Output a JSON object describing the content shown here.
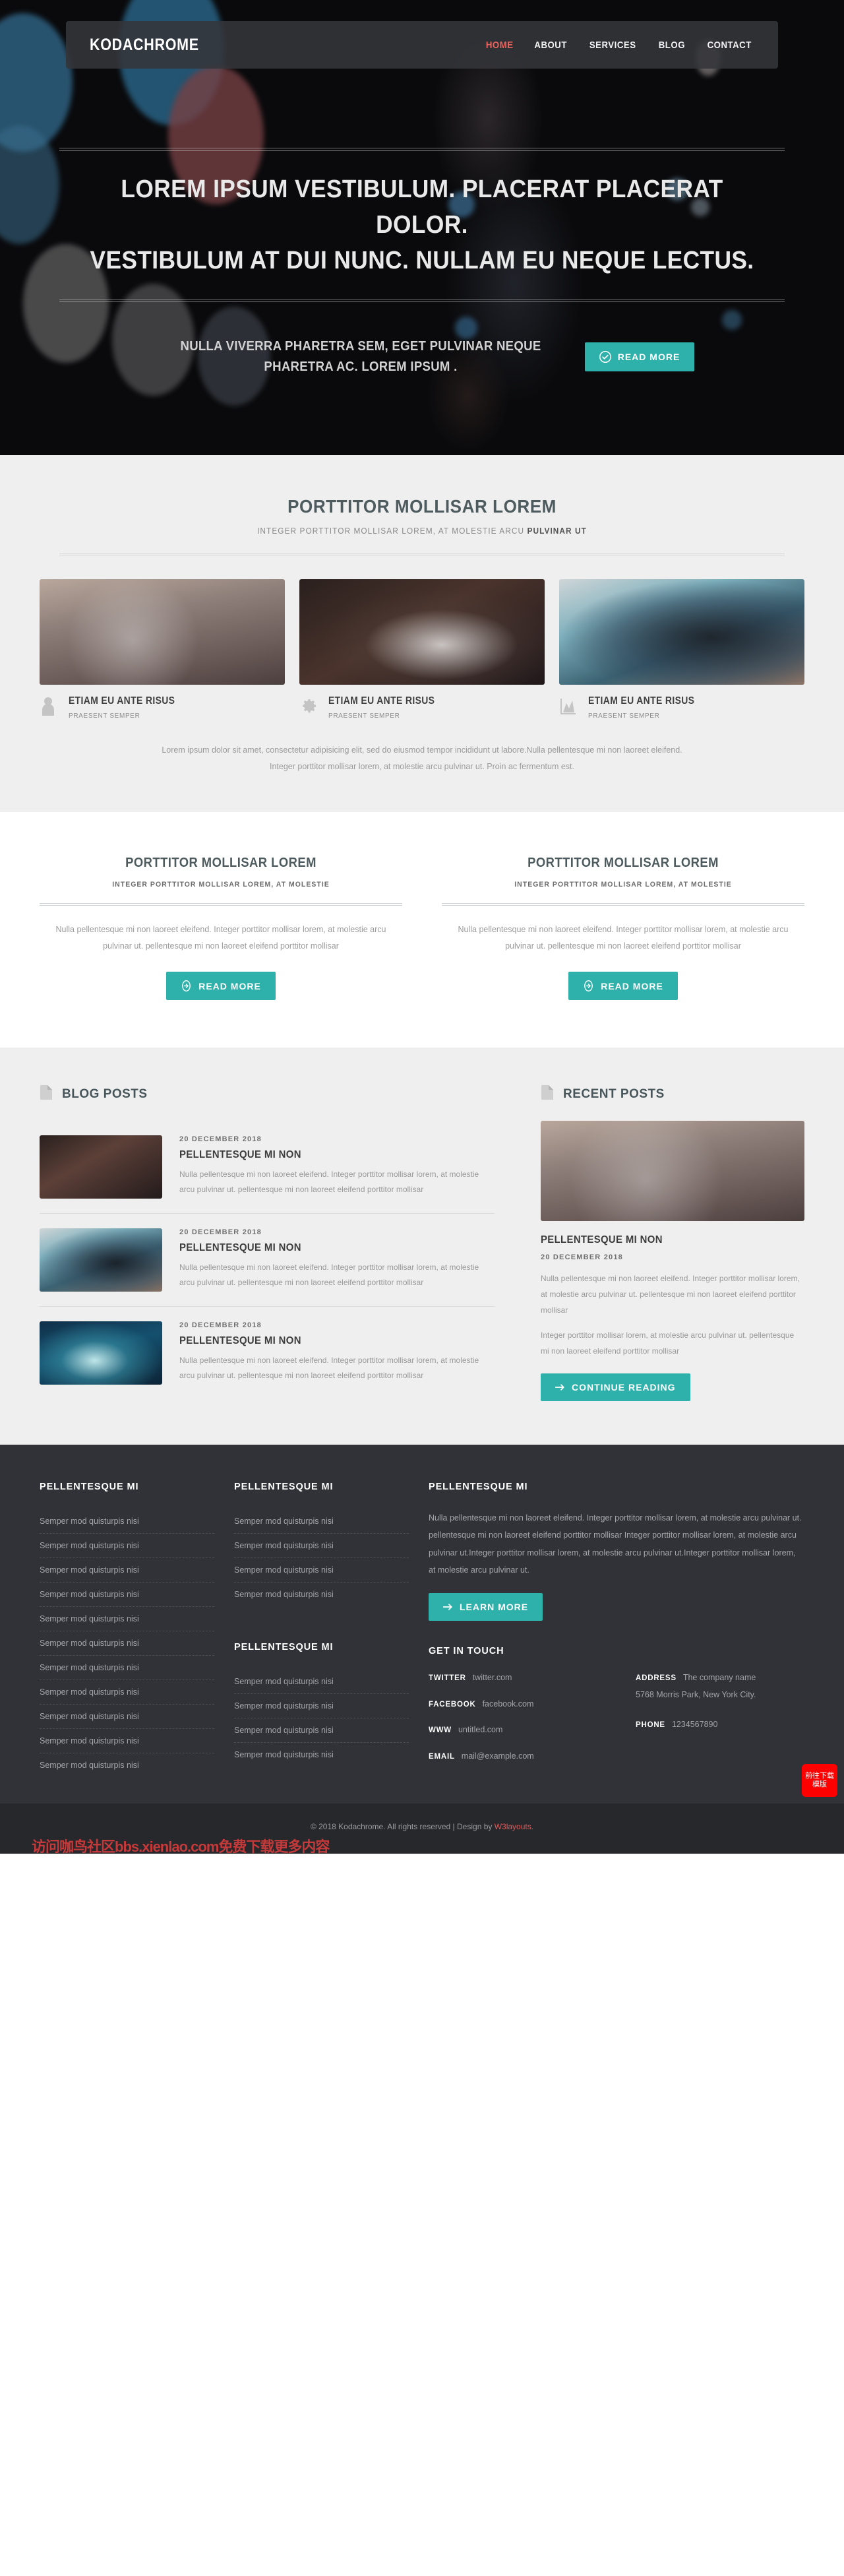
{
  "site": {
    "logo": "KODACHROME",
    "nav": [
      {
        "label": "HOME",
        "active": true
      },
      {
        "label": "ABOUT",
        "active": false
      },
      {
        "label": "SERVICES",
        "active": false
      },
      {
        "label": "BLOG",
        "active": false
      },
      {
        "label": "CONTACT",
        "active": false
      }
    ]
  },
  "hero": {
    "title_line1": "LOREM IPSUM VESTIBULUM. PLACERAT PLACERAT DOLOR.",
    "title_line2": "VESTIBULUM AT DUI NUNC. NULLAM EU NEQUE LECTUS.",
    "subtitle": "NULLA VIVERRA PHARETRA SEM, EGET PULVINAR NEQUE PHARETRA AC. LOREM IPSUM .",
    "button_label": "READ MORE",
    "button_icon": "check-circle-icon"
  },
  "gallery_section": {
    "title": "PORTTITOR MOLLISAR LOREM",
    "subtitle_normal": "INTEGER PORTTITOR MOLLISAR LOREM, AT MOLESTIE ARCU ",
    "subtitle_bold": "PULVINAR UT",
    "features": [
      {
        "icon": "user-icon",
        "title": "ETIAM EU ANTE RISUS",
        "subtitle": "PRAESENT SEMPER"
      },
      {
        "icon": "gear-icon",
        "title": "ETIAM EU ANTE RISUS",
        "subtitle": "PRAESENT SEMPER"
      },
      {
        "icon": "chart-icon",
        "title": "ETIAM EU ANTE RISUS",
        "subtitle": "PRAESENT SEMPER"
      }
    ],
    "paragraph_line1": "Lorem ipsum dolor sit amet, consectetur adipisicing elit, sed do eiusmod tempor incididunt ut labore.Nulla pellentesque mi non laoreet eleifend.",
    "paragraph_line2": "Integer porttitor mollisar lorem, at molestie arcu pulvinar ut. Proin ac fermentum est."
  },
  "two_columns": [
    {
      "title": "PORTTITOR MOLLISAR LOREM",
      "subtitle": "INTEGER PORTTITOR MOLLISAR LOREM, AT MOLESTIE",
      "paragraph": "Nulla pellentesque mi non laoreet eleifend. Integer porttitor mollisar lorem, at molestie arcu pulvinar ut. pellentesque mi non laoreet eleifend porttitor mollisar",
      "button_label": "READ MORE",
      "button_icon": "arrow-circle-right-icon"
    },
    {
      "title": "PORTTITOR MOLLISAR LOREM",
      "subtitle": "INTEGER PORTTITOR MOLLISAR LOREM, AT MOLESTIE",
      "paragraph": "Nulla pellentesque mi non laoreet eleifend. Integer porttitor mollisar lorem, at molestie arcu pulvinar ut. pellentesque mi non laoreet eleifend porttitor mollisar",
      "button_label": "READ MORE",
      "button_icon": "arrow-circle-right-icon"
    }
  ],
  "blog": {
    "heading": "BLOG POSTS",
    "heading_icon": "document-icon",
    "posts": [
      {
        "date": "20 DECEMBER 2018",
        "title": "PELLENTESQUE MI NON",
        "text": "Nulla pellentesque mi non laoreet eleifend. Integer porttitor mollisar lorem, at molestie arcu pulvinar ut. pellentesque mi non laoreet eleifend porttitor mollisar"
      },
      {
        "date": "20 DECEMBER 2018",
        "title": "PELLENTESQUE MI NON",
        "text": "Nulla pellentesque mi non laoreet eleifend. Integer porttitor mollisar lorem, at molestie arcu pulvinar ut. pellentesque mi non laoreet eleifend porttitor mollisar"
      },
      {
        "date": "20 DECEMBER 2018",
        "title": "PELLENTESQUE MI NON",
        "text": "Nulla pellentesque mi non laoreet eleifend. Integer porttitor mollisar lorem, at molestie arcu pulvinar ut. pellentesque mi non laoreet eleifend porttitor mollisar"
      }
    ]
  },
  "recent": {
    "heading": "RECENT POSTS",
    "heading_icon": "document-icon",
    "title": "PELLENTESQUE MI NON",
    "date": "20 DECEMBER 2018",
    "text1": "Nulla pellentesque mi non laoreet eleifend. Integer porttitor mollisar lorem, at molestie arcu pulvinar ut. pellentesque mi non laoreet eleifend porttitor mollisar",
    "text2": "Integer porttitor mollisar lorem, at molestie arcu pulvinar ut. pellentesque mi non laoreet eleifend porttitor mollisar",
    "button_label": "CONTINUE READING",
    "button_icon": "arrow-right-icon"
  },
  "footer": {
    "col1": {
      "heading": "PELLENTESQUE MI",
      "links": [
        "Semper mod quisturpis nisi",
        "Semper mod quisturpis nisi",
        "Semper mod quisturpis nisi",
        "Semper mod quisturpis nisi",
        "Semper mod quisturpis nisi",
        "Semper mod quisturpis nisi",
        "Semper mod quisturpis nisi",
        "Semper mod quisturpis nisi",
        "Semper mod quisturpis nisi",
        "Semper mod quisturpis nisi",
        "Semper mod quisturpis nisi"
      ]
    },
    "col2": {
      "heading": "PELLENTESQUE MI",
      "links": [
        "Semper mod quisturpis nisi",
        "Semper mod quisturpis nisi",
        "Semper mod quisturpis nisi",
        "Semper mod quisturpis nisi"
      ]
    },
    "col2b": {
      "heading": "PELLENTESQUE MI",
      "links": [
        "Semper mod quisturpis nisi",
        "Semper mod quisturpis nisi",
        "Semper mod quisturpis nisi",
        "Semper mod quisturpis nisi"
      ]
    },
    "col3": {
      "heading": "PELLENTESQUE MI",
      "text": "Nulla pellentesque mi non laoreet eleifend. Integer porttitor mollisar lorem, at molestie arcu pulvinar ut. pellentesque mi non laoreet eleifend porttitor mollisar Integer porttitor mollisar lorem, at molestie arcu pulvinar ut.Integer porttitor mollisar lorem, at molestie arcu pulvinar ut.Integer porttitor mollisar lorem, at molestie arcu pulvinar ut.",
      "button_label": "LEARN MORE",
      "button_icon": "arrow-right-icon"
    },
    "contact": {
      "heading": "GET IN TOUCH",
      "twitter_label": "TWITTER",
      "twitter_value": "twitter.com",
      "facebook_label": "FACEBOOK",
      "facebook_value": "facebook.com",
      "www_label": "WWW",
      "www_value": "untitled.com",
      "email_label": "EMAIL",
      "email_value": "mail@example.com",
      "address_label": "ADDRESS",
      "address_value": "The company name",
      "address_line2": "5768 Morris Park, New York City.",
      "phone_label": "PHONE",
      "phone_value": "1234567890"
    }
  },
  "copyright": {
    "text": "© 2018 Kodachrome. All rights reserved | Design by ",
    "link": "W3layouts.",
    "watermark": "访问咖鸟社区bbs.xienlao.com免费下载更多内容",
    "download_badge": "前往下载模版"
  },
  "colors": {
    "accent_teal": "#2fb1ab",
    "nav_active": "#e8645e",
    "footer_bg": "#303238",
    "heading": "#4d5b5e",
    "badge_red": "#fe0000"
  }
}
